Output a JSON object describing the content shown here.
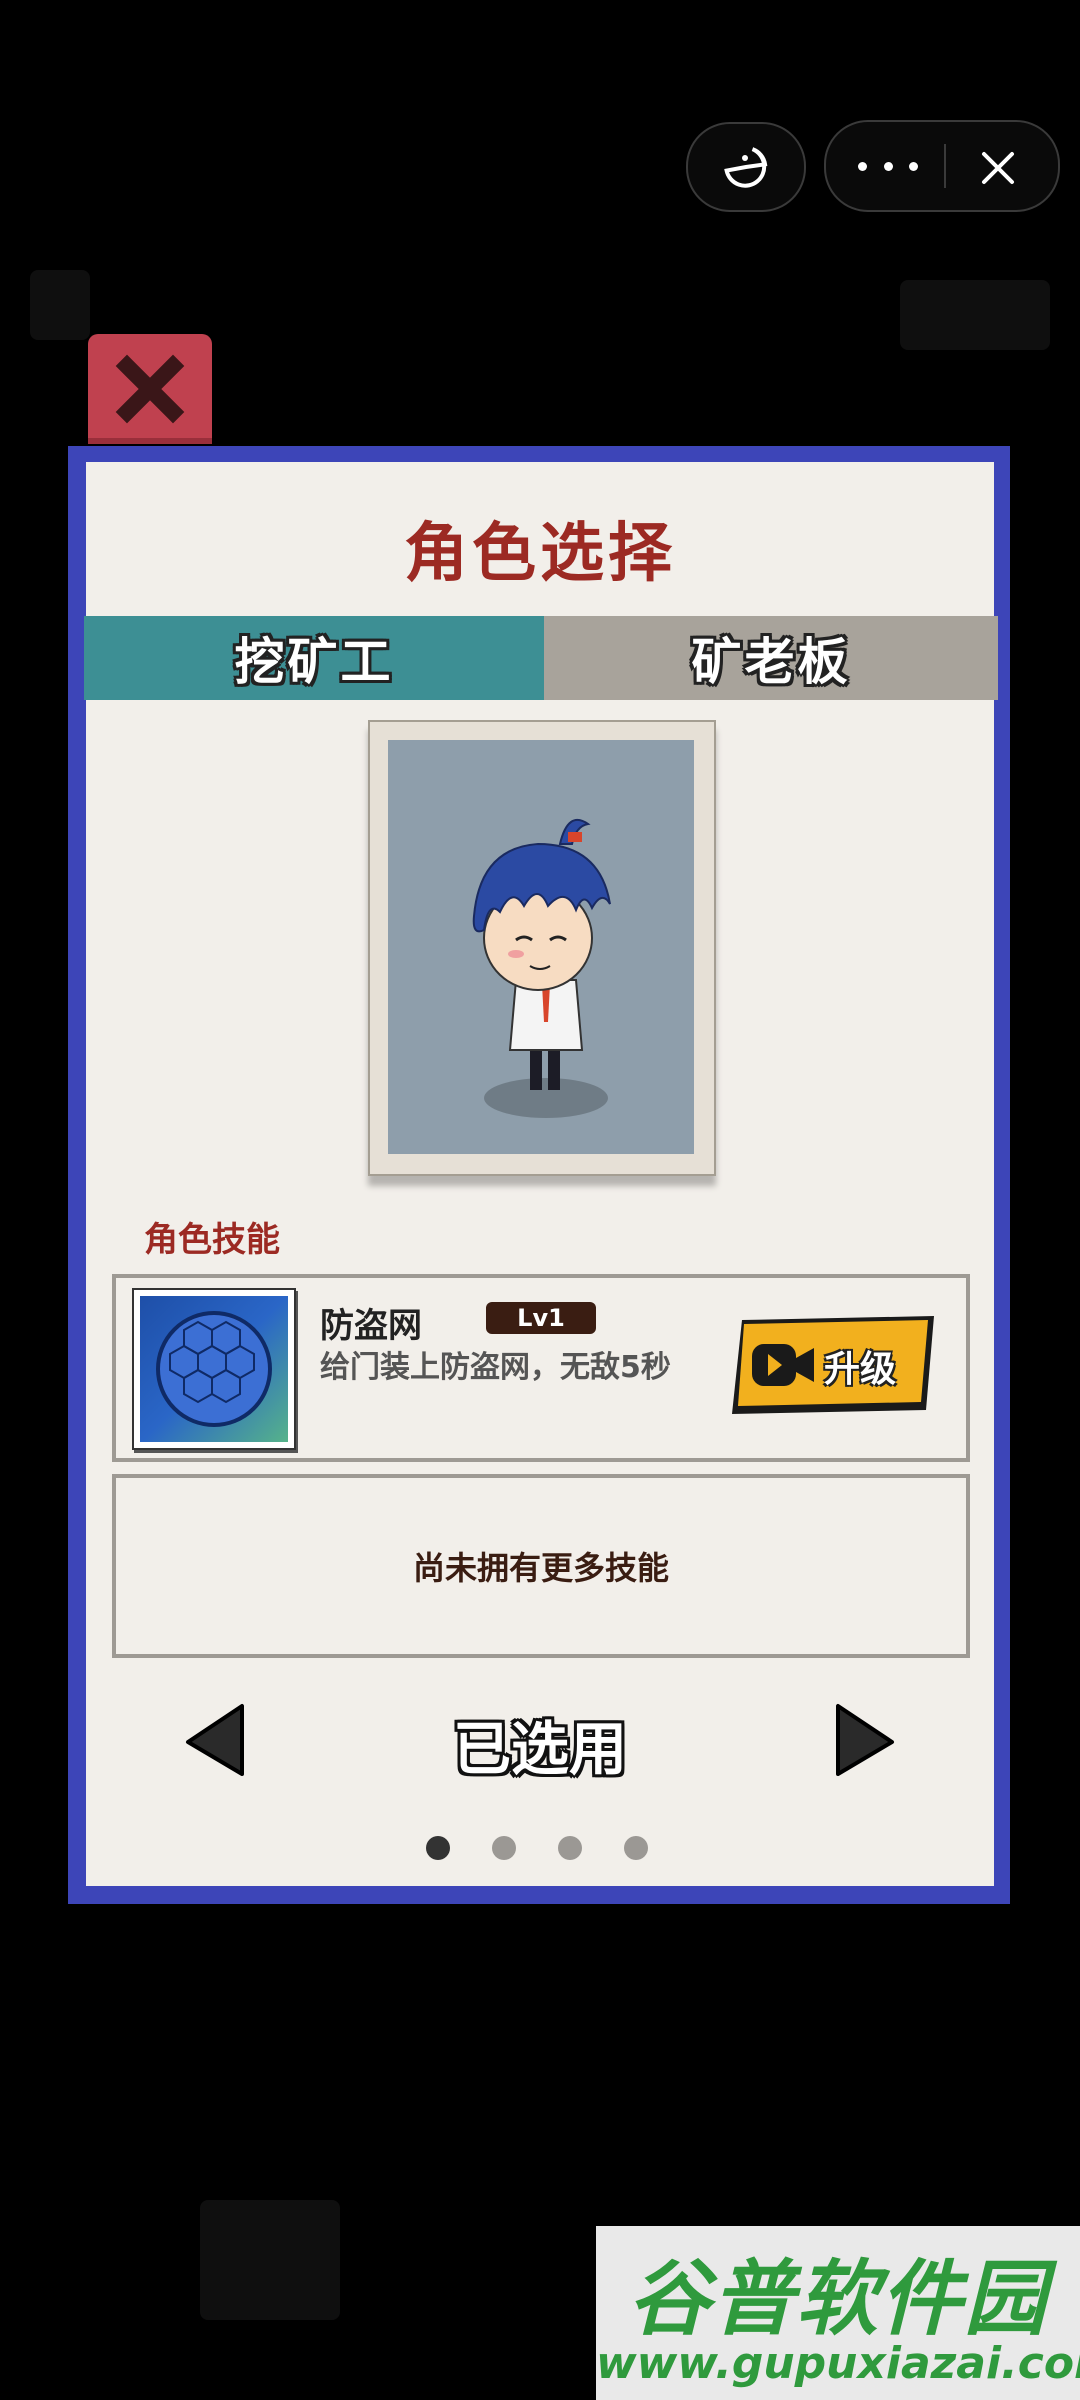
{
  "top_bar": {
    "left_icon": "pacman-icon",
    "more_icon": "more-dots-icon",
    "close_icon": "close-icon"
  },
  "modal": {
    "close_icon": "close-x-icon",
    "title": "角色选择",
    "tabs": [
      {
        "label": "挖矿工",
        "active": true
      },
      {
        "label": "矿老板",
        "active": false
      }
    ],
    "skills_heading": "角色技能",
    "skill": {
      "name": "防盗网",
      "level": "Lv1",
      "description": "给门装上防盗网，无敌5秒",
      "upgrade_label": "升级",
      "upgrade_icon": "video-camera-icon"
    },
    "no_more_skills": "尚未拥有更多技能",
    "status_label": "已选用",
    "pager": {
      "count": 4,
      "active": 0
    }
  },
  "colors": {
    "modal_border": "#3d45b8",
    "panel_bg": "#f2efea",
    "title_red": "#9c2a23",
    "tab_active": "#3d8f94",
    "tab_inactive": "#a8a39b",
    "close_red": "#c0414f",
    "upgrade_yellow": "#f2b01e"
  },
  "watermark": {
    "title": "谷普软件园",
    "url": "www.gupuxiazai.com"
  }
}
